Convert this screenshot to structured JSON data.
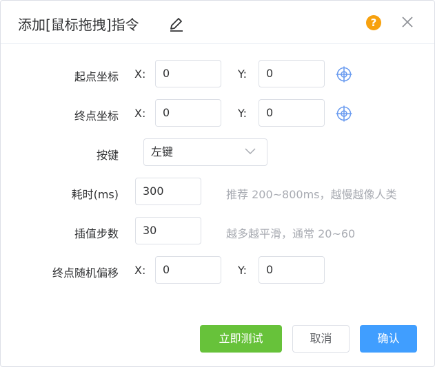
{
  "dialog": {
    "title": "添加[鼠标拖拽]指令",
    "help_glyph": "?",
    "icons": {
      "edit": "pencil-icon",
      "help": "question-mark-icon",
      "close": "close-icon"
    }
  },
  "form": {
    "start": {
      "label": "起点坐标",
      "x_label": "X:",
      "x_value": "0",
      "y_label": "Y:",
      "y_value": "0"
    },
    "end": {
      "label": "终点坐标",
      "x_label": "X:",
      "x_value": "0",
      "y_label": "Y:",
      "y_value": "0"
    },
    "button": {
      "label": "按键",
      "selected": "左键"
    },
    "duration": {
      "label": "耗时(ms)",
      "value": "300",
      "hint": "推荐 200~800ms，越慢越像人类"
    },
    "steps": {
      "label": "插值步数",
      "value": "30",
      "hint": "越多越平滑，通常 20~60"
    },
    "jitter": {
      "label": "终点随机偏移",
      "x_label": "X:",
      "x_value": "0",
      "y_label": "Y:",
      "y_value": "0"
    }
  },
  "footer": {
    "test_label": "立即测试",
    "cancel_label": "取消",
    "confirm_label": "确认"
  },
  "colors": {
    "test": "#67c23a",
    "confirm": "#409eff",
    "help": "#f7a10e",
    "target_icon": "#6b9cf0"
  }
}
